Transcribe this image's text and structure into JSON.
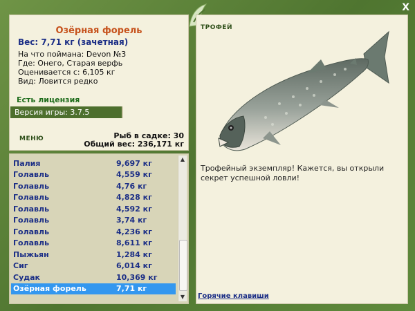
{
  "window": {
    "close_label": "X"
  },
  "info": {
    "fish_name": "Озёрная форель",
    "weight_line": "Вес: 7,71 кг (зачетная)",
    "bait": "На что поймана: Devon №3",
    "location": "Где: Онего, Старая верфь",
    "value": "Оценивается с: 6,105 кг",
    "species": "Вид: Ловится редко",
    "license": "Есть лицензия",
    "version": "Версия игры: 3.7.5",
    "menu_label": "МЕНЮ",
    "catch_count": "Рыб в садке: 30",
    "total_weight": "Общий вес: 236,171 кг"
  },
  "catch_list": [
    {
      "name": "Палия",
      "weight": "9,697 кг"
    },
    {
      "name": "Голавль",
      "weight": "4,559 кг"
    },
    {
      "name": "Голавль",
      "weight": "4,76 кг"
    },
    {
      "name": "Голавль",
      "weight": "4,828 кг"
    },
    {
      "name": "Голавль",
      "weight": "4,592 кг"
    },
    {
      "name": "Голавль",
      "weight": "3,74 кг"
    },
    {
      "name": "Голавль",
      "weight": "4,236 кг"
    },
    {
      "name": "Голавль",
      "weight": "8,611 кг"
    },
    {
      "name": "Пыжьян",
      "weight": "1,284 кг"
    },
    {
      "name": "Сиг",
      "weight": "6,014 кг"
    },
    {
      "name": "Судак",
      "weight": "10,369 кг"
    },
    {
      "name": "Озёрная форель",
      "weight": "7,71 кг"
    }
  ],
  "selected_index": 11,
  "trophy": {
    "title": "ТРОФЕЙ",
    "message": "Трофейный экземпляр! Кажется, вы открыли секрет успешной ловли!",
    "hotkeys": "Горячие клавиши"
  },
  "colors": {
    "frame": "#5b7f3a",
    "panel": "#f4f1de",
    "list_bg": "#d8d5b8",
    "selected": "#3397ef",
    "title": "#c6521c",
    "link": "#1c2f86"
  }
}
